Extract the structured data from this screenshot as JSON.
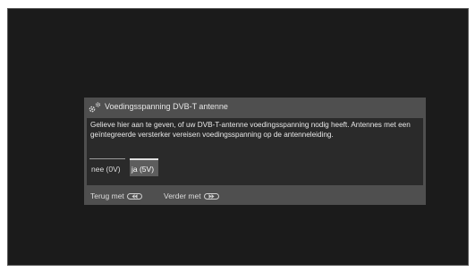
{
  "dialog": {
    "title": "Voedingsspanning DVB-T antenne",
    "title_icon": "settings-gears-icon",
    "message": "Gelieve hier aan te geven, of uw DVB-T-antenne voedingsspanning nodig heeft. Antennes met een geïntegreerde versterker vereisen voedingsspanning op de antenneleiding.",
    "options": [
      {
        "label": "nee (0V)",
        "selected": false
      },
      {
        "label": "ja (5V)",
        "selected": true
      }
    ],
    "footer": {
      "back_label": "Terug met",
      "back_icon": "rewind-key-icon",
      "next_label": "Verder met",
      "next_icon": "fast-forward-key-icon"
    }
  }
}
